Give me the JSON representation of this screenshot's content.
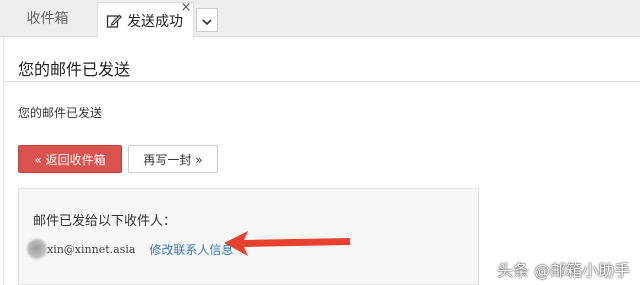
{
  "tabs": {
    "inbox_label": "收件箱",
    "active_label": "发送成功",
    "close_glyph": "×",
    "dropdown_icon": "chevron-down-icon"
  },
  "page": {
    "title": "您的邮件已发送",
    "message": "您的邮件已发送"
  },
  "buttons": {
    "back_label": "« 返回收件箱",
    "write_again_label": "再写一封 »"
  },
  "recipients": {
    "heading": "邮件已发给以下收件人：",
    "items": [
      {
        "email": "xin@xinnet.asia",
        "edit_label": "修改联系人信息"
      }
    ]
  },
  "annotation": {
    "arrow_color": "#e8412f",
    "watermark": "头条 @邮箱小助手"
  },
  "colors": {
    "accent_red": "#d9534f",
    "link_blue": "#3a7ab8"
  }
}
